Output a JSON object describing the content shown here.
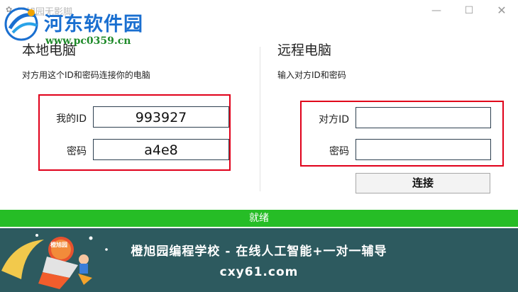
{
  "window": {
    "title": "橙旭园无影脚",
    "controls": {
      "minimize": "—",
      "maximize": "☐",
      "close": "✕"
    }
  },
  "watermark": {
    "name": "河东软件园",
    "url": "www.pc0359.cn"
  },
  "local": {
    "heading": "本地电脑",
    "description": "对方用这个ID和密码连接你的电脑",
    "id_label": "我的ID",
    "id_value": "993927",
    "password_label": "密码",
    "password_value": "a4e8"
  },
  "remote": {
    "heading": "远程电脑",
    "description": "输入对方ID和密码",
    "id_label": "对方ID",
    "id_value": "",
    "password_label": "密码",
    "password_value": "",
    "connect_label": "连接"
  },
  "status": {
    "text": "就绪",
    "color": "#26bd26"
  },
  "banner": {
    "line1": "橙旭园编程学校 - 在线人工智能+一对一辅导",
    "line2": "cxy61.com",
    "badge": "橙旭园"
  },
  "colors": {
    "highlight_frame": "#e0001a",
    "banner_bg": "#2d5a5f"
  }
}
